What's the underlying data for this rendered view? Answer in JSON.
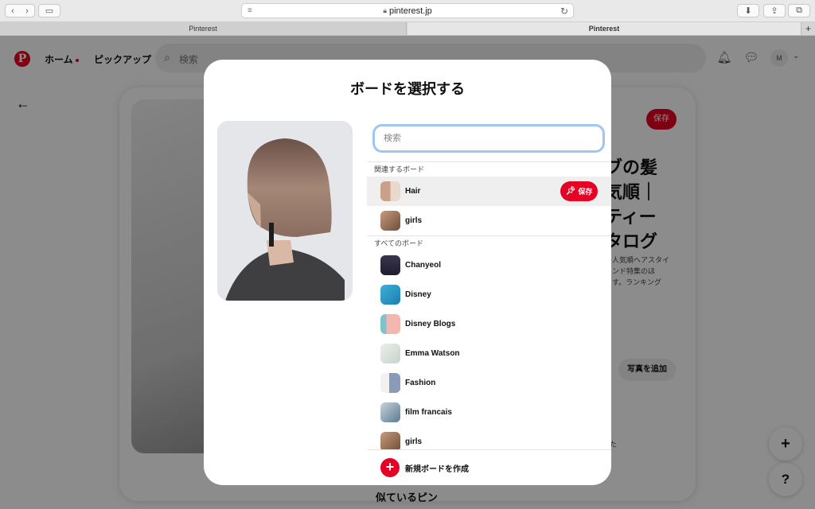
{
  "browser": {
    "url": "pinterest.jp",
    "tabs": [
      {
        "label": "Pinterest"
      },
      {
        "label": "Pinterest"
      }
    ]
  },
  "header": {
    "logo": "P",
    "nav_home": "ホーム",
    "nav_pickup": "ピックアップ",
    "search_placeholder": "検索",
    "avatar_initial": "M"
  },
  "background_pin": {
    "save_label": "保存",
    "title_lines": [
      "ブの髪",
      "気順｜",
      "ティー",
      "タログ"
    ],
    "desc_lines": [
      "の人気順ヘアスタイ",
      "レンド特集のほ",
      "ます。ランキング"
    ],
    "add_photo_label": "写真を追加",
    "side_text": "た",
    "similar_pins": "似ているピン"
  },
  "modal": {
    "title": "ボードを選択する",
    "search_placeholder": "検索",
    "related_header": "関連するボード",
    "related_boards": [
      {
        "name": "Hair",
        "save_label": "保存",
        "highlighted": true,
        "thumb_colors": [
          "#c9a08a",
          "#e8d9cf"
        ]
      },
      {
        "name": "girls",
        "highlighted": false,
        "thumb_colors": [
          "#b58a6a",
          "#7a5a45"
        ]
      }
    ],
    "all_header": "すべてのボード",
    "all_boards": [
      {
        "name": "Chanyeol",
        "thumb_colors": [
          "#1f1d2e",
          "#3a3550"
        ]
      },
      {
        "name": "Disney",
        "thumb_colors": [
          "#1a7fb0",
          "#3fb0d8"
        ]
      },
      {
        "name": "Disney Blogs",
        "thumb_colors": [
          "#f2b8b0",
          "#7fc3c9"
        ]
      },
      {
        "name": "Emma Watson",
        "thumb_colors": [
          "#e9efe9",
          "#c7d3cc"
        ]
      },
      {
        "name": "Fashion",
        "thumb_colors": [
          "#f1f1f1",
          "#8a9bb8"
        ]
      },
      {
        "name": "film francais",
        "thumb_colors": [
          "#5c7a93",
          "#c8d3dc"
        ]
      },
      {
        "name": "girls",
        "thumb_colors": [
          "#b58a6a",
          "#7a5a45"
        ]
      }
    ],
    "create_label": "新規ボードを作成"
  }
}
